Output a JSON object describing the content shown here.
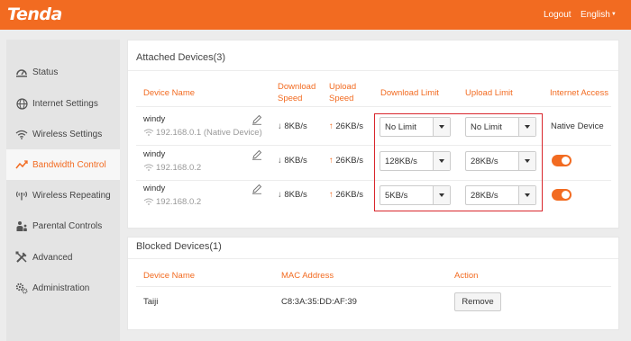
{
  "header": {
    "brand": "Tenda",
    "logout": "Logout",
    "language": "English"
  },
  "sidebar": {
    "items": [
      {
        "label": "Status",
        "icon": "dashboard-icon"
      },
      {
        "label": "Internet Settings",
        "icon": "globe-icon"
      },
      {
        "label": "Wireless Settings",
        "icon": "wifi-icon"
      },
      {
        "label": "Bandwidth Control",
        "icon": "bandwidth-icon",
        "active": true
      },
      {
        "label": "Wireless Repeating",
        "icon": "repeater-icon"
      },
      {
        "label": "Parental Controls",
        "icon": "parental-icon"
      },
      {
        "label": "Advanced",
        "icon": "tools-icon"
      },
      {
        "label": "Administration",
        "icon": "gear-icon"
      }
    ]
  },
  "attached": {
    "title": "Attached Devices(3)",
    "headers": {
      "device_name": "Device Name",
      "download_speed_1": "Download",
      "download_speed_2": "Speed",
      "upload_speed_1": "Upload",
      "upload_speed_2": "Speed",
      "download_limit": "Download Limit",
      "upload_limit": "Upload Limit",
      "internet_access": "Internet Access"
    },
    "rows": [
      {
        "name": "windy",
        "ip": "192.168.0.1 (Native Device)",
        "down": "8KB/s",
        "up": "26KB/s",
        "down_limit": "No Limit",
        "up_limit": "No Limit",
        "access": "Native Device",
        "access_on": null
      },
      {
        "name": "windy",
        "ip": "192.168.0.2",
        "down": "8KB/s",
        "up": "26KB/s",
        "down_limit": "128KB/s",
        "up_limit": "28KB/s",
        "access": "",
        "access_on": true
      },
      {
        "name": "windy",
        "ip": "192.168.0.2",
        "down": "8KB/s",
        "up": "26KB/s",
        "down_limit": "5KB/s",
        "up_limit": "28KB/s",
        "access": "",
        "access_on": true
      }
    ]
  },
  "blocked": {
    "title": "Blocked Devices(1)",
    "headers": {
      "device_name": "Device Name",
      "mac": "MAC Address",
      "action": "Action"
    },
    "rows": [
      {
        "name": "Taiji",
        "mac": "C8:3A:35:DD:AF:39",
        "action": "Remove"
      }
    ]
  },
  "colors": {
    "accent": "#f26b21",
    "highlight_box": "#d9262c"
  }
}
